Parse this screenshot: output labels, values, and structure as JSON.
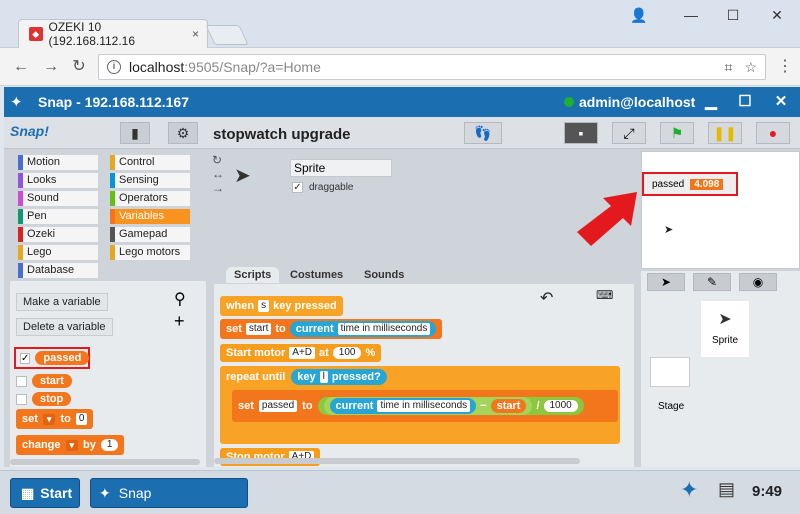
{
  "browser": {
    "tab_title": "OZEKI 10 (192.168.112.16",
    "tab_close": "×",
    "url_host": "localhost",
    "url_path": ":9505/Snap/?a=Home",
    "win_min": "—",
    "win_max": "☐",
    "win_close": "✕"
  },
  "snap": {
    "title": "Snap - 192.168.112.167",
    "user": "admin@localhost",
    "logo_text": "Snap!",
    "project_name": "stopwatch upgrade"
  },
  "categories": [
    {
      "label": "Motion",
      "color": "#4a6cd4"
    },
    {
      "label": "Control",
      "color": "#e6a822"
    },
    {
      "label": "Looks",
      "color": "#8f56e3"
    },
    {
      "label": "Sensing",
      "color": "#0494dc"
    },
    {
      "label": "Sound",
      "color": "#cf4ad9"
    },
    {
      "label": "Operators",
      "color": "#62c213"
    },
    {
      "label": "Pen",
      "color": "#0e9a6c"
    },
    {
      "label": "Variables",
      "color": "#f3761d"
    },
    {
      "label": "Ozeki",
      "color": "#d9231c"
    },
    {
      "label": "Gamepad",
      "color": "#555555"
    },
    {
      "label": "Lego",
      "color": "#e6a822"
    },
    {
      "label": "Lego motors",
      "color": "#e6a822"
    },
    {
      "label": "Database",
      "color": "#4a6cd4"
    }
  ],
  "palette": {
    "make_variable": "Make a variable",
    "delete_variable": "Delete a variable",
    "variables": [
      {
        "name": "passed",
        "checked": "✓"
      },
      {
        "name": "start",
        "checked": ""
      },
      {
        "name": "stop",
        "checked": ""
      }
    ],
    "set_label": "set",
    "to_label": "to",
    "set_value": "0",
    "change_label": "change",
    "by_label": "by",
    "change_value": "1"
  },
  "sprite": {
    "name": "Sprite",
    "draggable_label": "draggable",
    "draggable_check": "✓"
  },
  "tabs": [
    "Scripts",
    "Costumes",
    "Sounds"
  ],
  "script": {
    "when_label": "when",
    "key_value": "s",
    "key_pressed": "key pressed",
    "set_label": "set",
    "start_var": "start",
    "to_label": "to",
    "current": "current",
    "time_ms": "time in milliseconds",
    "start_motor": "Start motor",
    "motor_port": "A+D",
    "at_label": "at",
    "speed": "100",
    "percent": "%",
    "repeat_until": "repeat until",
    "key_label": "key",
    "key2_value": "l",
    "pressed": "pressed?",
    "passed_var": "passed",
    "minus": "−",
    "start_reporter": "start",
    "divide": "/",
    "divisor": "1000",
    "stop_motor": "Stop motor",
    "stop_port": "A+D"
  },
  "stage": {
    "watcher_label": "passed",
    "watcher_value": "4.098"
  },
  "corral": {
    "sprite_label": "Sprite",
    "stage_label": "Stage"
  },
  "taskbar": {
    "start": "Start",
    "app": "Snap",
    "time": "9:49"
  }
}
